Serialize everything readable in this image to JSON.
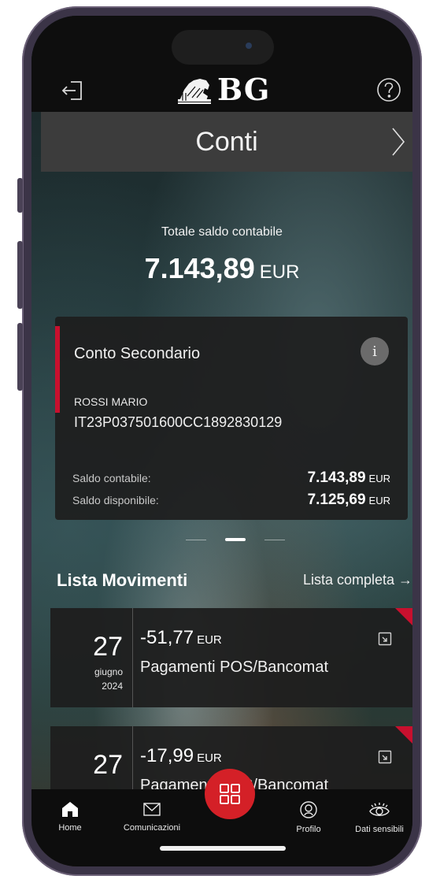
{
  "header": {
    "logo_text": "BG",
    "title": "Conti"
  },
  "summary": {
    "label": "Totale saldo contabile",
    "amount": "7.143,89",
    "currency": "EUR"
  },
  "account_card": {
    "name": "Conto Secondario",
    "info_glyph": "i",
    "holder": "ROSSI MARIO",
    "iban": "IT23P037501600CC1892830129",
    "balances": [
      {
        "label": "Saldo contabile:",
        "value": "7.143,89",
        "currency": "EUR"
      },
      {
        "label": "Saldo disponibile:",
        "value": "7.125,69",
        "currency": "EUR"
      }
    ],
    "accent_color": "#c8102e"
  },
  "carousel": {
    "pages": 3,
    "active_index": 1
  },
  "movements": {
    "title": "Lista Movimenti",
    "link": "Lista completa →",
    "items": [
      {
        "day": "27",
        "month": "giugno",
        "year": "2024",
        "amount": "-51,77",
        "currency": "EUR",
        "description": "Pagamenti POS/Bancomat"
      },
      {
        "day": "27",
        "amount": "-17,99",
        "currency": "EUR",
        "description": "Pagamenti POS/Bancomat"
      }
    ]
  },
  "tabs": [
    {
      "label": "Home",
      "icon": "home-icon"
    },
    {
      "label": "Comunicazioni",
      "icon": "envelope-icon"
    },
    {
      "label": "Profilo",
      "icon": "profile-icon"
    },
    {
      "label": "Dati sensibili",
      "icon": "eye-icon"
    }
  ],
  "fab": {
    "icon": "grid-icon",
    "color": "#d42027"
  },
  "icons": {
    "logout": "logout-icon",
    "help": "help-icon",
    "header_nav": "chevron-right-icon"
  }
}
